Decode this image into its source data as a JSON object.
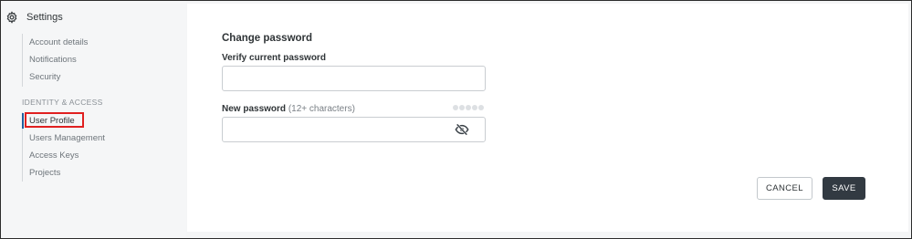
{
  "sidebar": {
    "settings_title": "Settings",
    "group1": [
      {
        "label": "Account details"
      },
      {
        "label": "Notifications"
      },
      {
        "label": "Security"
      }
    ],
    "section_label": "IDENTITY & ACCESS",
    "group2": [
      {
        "label": "User Profile",
        "active": true
      },
      {
        "label": "Users Management"
      },
      {
        "label": "Access Keys"
      },
      {
        "label": "Projects"
      }
    ]
  },
  "form": {
    "title": "Change password",
    "current_password": {
      "label": "Verify current password",
      "value": "",
      "placeholder": ""
    },
    "new_password": {
      "label": "New password",
      "hint": "(12+ characters)",
      "value": "",
      "placeholder": "",
      "strength_level": 0,
      "strength_max": 5,
      "visibility_icon": "eye-slash-icon"
    }
  },
  "actions": {
    "cancel_label": "CANCEL",
    "save_label": "SAVE"
  },
  "colors": {
    "accent": "#1f5f9e",
    "save_button": "#323a42",
    "highlight": "#e02020"
  }
}
